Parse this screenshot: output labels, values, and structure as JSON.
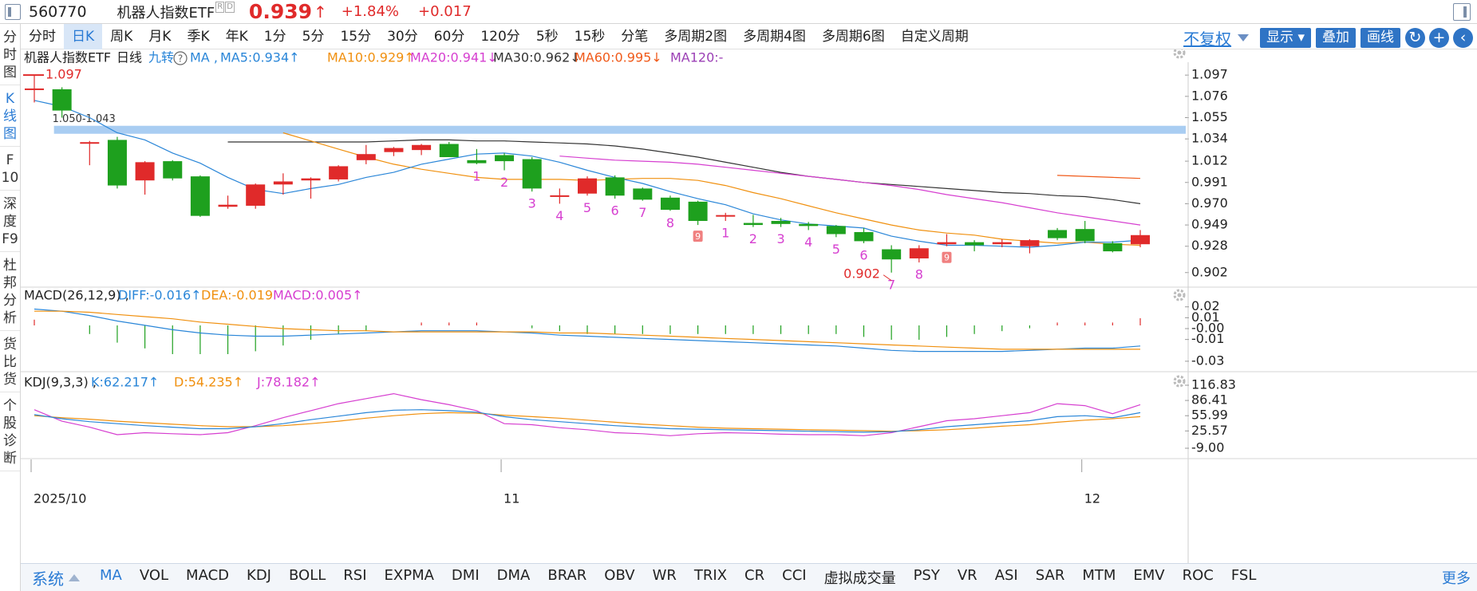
{
  "quote": {
    "code": "560770",
    "name": "机器人指数ETF",
    "badges": [
      "R",
      "D"
    ],
    "price": "0.939",
    "price_arrow": "↑",
    "change_pct": "+1.84%",
    "change_abs": "+0.017"
  },
  "sidebar": {
    "items": [
      {
        "label": "分时图",
        "lines": [
          "分",
          "时",
          "图"
        ],
        "active": false
      },
      {
        "label": "K线图",
        "lines": [
          "K",
          "线",
          "图"
        ],
        "active": true
      },
      {
        "label": "F10",
        "lines": [
          "F",
          "10"
        ],
        "active": false
      },
      {
        "label": "深度F9",
        "lines": [
          "深",
          "度",
          "F9"
        ],
        "active": false
      },
      {
        "label": "杜邦分析",
        "lines": [
          "杜",
          "邦",
          "分",
          "析"
        ],
        "active": false
      },
      {
        "label": "货比货",
        "lines": [
          "货",
          "比",
          "货"
        ],
        "active": false
      },
      {
        "label": "个股诊断",
        "lines": [
          "个",
          "股",
          "诊",
          "断"
        ],
        "active": false
      }
    ]
  },
  "period_tabs": [
    {
      "label": "分时",
      "active": false
    },
    {
      "label": "日K",
      "active": true
    },
    {
      "label": "周K",
      "active": false
    },
    {
      "label": "月K",
      "active": false
    },
    {
      "label": "季K",
      "active": false
    },
    {
      "label": "年K",
      "active": false
    },
    {
      "label": "1分",
      "active": false
    },
    {
      "label": "5分",
      "active": false
    },
    {
      "label": "15分",
      "active": false
    },
    {
      "label": "30分",
      "active": false
    },
    {
      "label": "60分",
      "active": false
    },
    {
      "label": "120分",
      "active": false
    },
    {
      "label": "5秒",
      "active": false
    },
    {
      "label": "15秒",
      "active": false
    },
    {
      "label": "分笔",
      "active": false
    },
    {
      "label": "多周期2图",
      "active": false
    },
    {
      "label": "多周期4图",
      "active": false
    },
    {
      "label": "多周期6图",
      "active": false
    },
    {
      "label": "自定义周期",
      "active": false
    }
  ],
  "toolbar": {
    "fuquan": "不复权",
    "display": "显示",
    "overlay": "叠加",
    "draw": "画线",
    "refresh_icon": "refresh-icon",
    "add_icon": "plus-icon",
    "collapse_icon": "chevron-left-icon"
  },
  "main_header": {
    "name": "机器人指数ETF",
    "period": "日线",
    "jiuzhuan": "九转",
    "ma_label": "MA ,",
    "items": [
      {
        "text": "MA5:0.934↑",
        "color": "#2a86d8"
      },
      {
        "text": "MA10:0.929↑",
        "color": "#f0900f"
      },
      {
        "text": "MA20:0.941↓",
        "color": "#d63fd0"
      },
      {
        "text": "MA30:0.962↓",
        "color": "#333333"
      },
      {
        "text": "MA60:0.995↓",
        "color": "#f05a1a"
      },
      {
        "text": "MA120:-",
        "color": "#9b3fb5"
      }
    ]
  },
  "price_axis": [
    "1.097",
    "1.076",
    "1.055",
    "1.034",
    "1.012",
    "0.991",
    "0.970",
    "0.949",
    "0.928",
    "0.902"
  ],
  "annotations": {
    "high_label": "1.097",
    "low_label": "0.902",
    "band_label": "1.050-1.043"
  },
  "macd_header": {
    "title": "MACD(26,12,9) ,",
    "diff": "DIFF:-0.016↑",
    "dea": "DEA:-0.019",
    "macd": "MACD:0.005↑"
  },
  "macd_axis": [
    "0.02",
    "0.01",
    "-0.00",
    "-0.01",
    "-0.03"
  ],
  "kdj_header": {
    "title": "KDJ(9,3,3) ,",
    "k": "K:62.217↑",
    "d": "D:54.235↑",
    "j": "J:78.182↑"
  },
  "kdj_axis": [
    "116.83",
    "86.41",
    "55.99",
    "25.57",
    "-9.00"
  ],
  "date_axis": [
    "2025/10",
    "11",
    "12"
  ],
  "indicator_bar": {
    "system": "系统",
    "items": [
      "MA",
      "VOL",
      "MACD",
      "KDJ",
      "BOLL",
      "RSI",
      "EXPMA",
      "DMI",
      "DMA",
      "BRAR",
      "OBV",
      "WR",
      "TRIX",
      "CR",
      "CCI",
      "虚拟成交量",
      "PSY",
      "VR",
      "ASI",
      "SAR",
      "MTM",
      "EMV",
      "ROC",
      "FSL"
    ],
    "active": "MA",
    "more": "更多"
  },
  "colors": {
    "up": "#e02a2a",
    "down": "#1ea01e",
    "ma5": "#2a86d8",
    "ma10": "#f0900f",
    "ma20": "#d63fd0",
    "ma30": "#333333",
    "ma60": "#f05a1a",
    "td_seq": "#d63fd0",
    "band": "#a9cdf2"
  },
  "chart_data": {
    "type": "candlestick",
    "ylim": [
      0.89,
      1.105
    ],
    "candles": [
      {
        "o": 1.083,
        "h": 1.097,
        "l": 1.07,
        "c": 1.083,
        "seq": ""
      },
      {
        "o": 1.083,
        "h": 1.085,
        "l": 1.055,
        "c": 1.062,
        "seq": ""
      },
      {
        "o": 1.03,
        "h": 1.032,
        "l": 1.008,
        "c": 1.03,
        "seq": ""
      },
      {
        "o": 1.033,
        "h": 1.036,
        "l": 0.985,
        "c": 0.988,
        "seq": ""
      },
      {
        "o": 0.993,
        "h": 1.012,
        "l": 0.979,
        "c": 1.011,
        "seq": ""
      },
      {
        "o": 1.012,
        "h": 1.013,
        "l": 0.993,
        "c": 0.995,
        "seq": ""
      },
      {
        "o": 0.997,
        "h": 0.998,
        "l": 0.957,
        "c": 0.958,
        "seq": ""
      },
      {
        "o": 0.967,
        "h": 0.978,
        "l": 0.965,
        "c": 0.969,
        "seq": ""
      },
      {
        "o": 0.968,
        "h": 0.99,
        "l": 0.965,
        "c": 0.989,
        "seq": ""
      },
      {
        "o": 0.989,
        "h": 1.0,
        "l": 0.979,
        "c": 0.992,
        "seq": ""
      },
      {
        "o": 0.993,
        "h": 0.996,
        "l": 0.975,
        "c": 0.995,
        "seq": ""
      },
      {
        "o": 0.994,
        "h": 1.008,
        "l": 0.992,
        "c": 1.007,
        "seq": ""
      },
      {
        "o": 1.013,
        "h": 1.028,
        "l": 1.009,
        "c": 1.019,
        "seq": ""
      },
      {
        "o": 1.021,
        "h": 1.026,
        "l": 1.017,
        "c": 1.025,
        "seq": ""
      },
      {
        "o": 1.023,
        "h": 1.029,
        "l": 1.018,
        "c": 1.028,
        "seq": ""
      },
      {
        "o": 1.029,
        "h": 1.031,
        "l": 1.016,
        "c": 1.016,
        "seq": ""
      },
      {
        "o": 1.013,
        "h": 1.024,
        "l": 1.009,
        "c": 1.01,
        "seq": "1"
      },
      {
        "o": 1.018,
        "h": 1.02,
        "l": 1.003,
        "c": 1.012,
        "seq": "2"
      },
      {
        "o": 1.014,
        "h": 1.016,
        "l": 0.982,
        "c": 0.985,
        "seq": "3"
      },
      {
        "o": 0.977,
        "h": 0.985,
        "l": 0.97,
        "c": 0.978,
        "seq": "4"
      },
      {
        "o": 0.98,
        "h": 0.997,
        "l": 0.978,
        "c": 0.995,
        "seq": "5"
      },
      {
        "o": 0.996,
        "h": 0.998,
        "l": 0.975,
        "c": 0.978,
        "seq": "6"
      },
      {
        "o": 0.985,
        "h": 0.986,
        "l": 0.973,
        "c": 0.974,
        "seq": "7"
      },
      {
        "o": 0.976,
        "h": 0.978,
        "l": 0.963,
        "c": 0.964,
        "seq": "8"
      },
      {
        "o": 0.972,
        "h": 0.973,
        "l": 0.949,
        "c": 0.953,
        "seq": "9"
      },
      {
        "o": 0.958,
        "h": 0.961,
        "l": 0.953,
        "c": 0.958,
        "seq": "1"
      },
      {
        "o": 0.951,
        "h": 0.959,
        "l": 0.947,
        "c": 0.949,
        "seq": "2"
      },
      {
        "o": 0.953,
        "h": 0.956,
        "l": 0.947,
        "c": 0.95,
        "seq": "3"
      },
      {
        "o": 0.95,
        "h": 0.952,
        "l": 0.944,
        "c": 0.948,
        "seq": "4"
      },
      {
        "o": 0.948,
        "h": 0.949,
        "l": 0.937,
        "c": 0.94,
        "seq": "5"
      },
      {
        "o": 0.942,
        "h": 0.946,
        "l": 0.931,
        "c": 0.933,
        "seq": "6"
      },
      {
        "o": 0.925,
        "h": 0.929,
        "l": 0.902,
        "c": 0.915,
        "seq": "7"
      },
      {
        "o": 0.916,
        "h": 0.929,
        "l": 0.912,
        "c": 0.926,
        "seq": "8"
      },
      {
        "o": 0.93,
        "h": 0.94,
        "l": 0.928,
        "c": 0.932,
        "seq": "9"
      },
      {
        "o": 0.932,
        "h": 0.934,
        "l": 0.923,
        "c": 0.929,
        "seq": ""
      },
      {
        "o": 0.93,
        "h": 0.935,
        "l": 0.927,
        "c": 0.932,
        "seq": ""
      },
      {
        "o": 0.928,
        "h": 0.935,
        "l": 0.921,
        "c": 0.934,
        "seq": ""
      },
      {
        "o": 0.944,
        "h": 0.946,
        "l": 0.934,
        "c": 0.936,
        "seq": ""
      },
      {
        "o": 0.945,
        "h": 0.953,
        "l": 0.931,
        "c": 0.933,
        "seq": ""
      },
      {
        "o": 0.931,
        "h": 0.933,
        "l": 0.922,
        "c": 0.923,
        "seq": ""
      },
      {
        "o": 0.93,
        "h": 0.944,
        "l": 0.927,
        "c": 0.939,
        "seq": ""
      }
    ],
    "hline": {
      "from": 1.05,
      "to": 1.043
    },
    "ma5": [
      1.072,
      1.066,
      1.055,
      1.04,
      1.033,
      1.02,
      1.01,
      0.996,
      0.984,
      0.98,
      0.985,
      0.989,
      0.996,
      1.001,
      1.009,
      1.014,
      1.019,
      1.02,
      1.017,
      1.011,
      1.003,
      0.996,
      0.99,
      0.982,
      0.975,
      0.969,
      0.96,
      0.954,
      0.95,
      0.948,
      0.946,
      0.938,
      0.933,
      0.929,
      0.929,
      0.928,
      0.927,
      0.929,
      0.932,
      0.932,
      0.934
    ],
    "ma10": [
      null,
      null,
      null,
      null,
      null,
      null,
      null,
      null,
      null,
      1.04,
      1.032,
      1.024,
      1.016,
      1.009,
      1.004,
      1.0,
      0.996,
      0.994,
      0.994,
      0.994,
      0.993,
      0.994,
      0.995,
      0.995,
      0.993,
      0.988,
      0.981,
      0.975,
      0.968,
      0.961,
      0.955,
      0.949,
      0.944,
      0.941,
      0.939,
      0.935,
      0.933,
      0.931,
      0.932,
      0.93,
      0.929
    ],
    "ma20": [
      null,
      null,
      null,
      null,
      null,
      null,
      null,
      null,
      null,
      null,
      null,
      null,
      null,
      null,
      null,
      null,
      null,
      null,
      null,
      1.017,
      1.015,
      1.013,
      1.012,
      1.011,
      1.009,
      1.006,
      1.003,
      1.0,
      0.997,
      0.994,
      0.991,
      0.988,
      0.984,
      0.979,
      0.975,
      0.971,
      0.966,
      0.961,
      0.957,
      0.953,
      0.949
    ],
    "ma30": [
      null,
      null,
      null,
      null,
      null,
      null,
      null,
      1.031,
      1.031,
      1.031,
      1.031,
      1.031,
      1.031,
      1.032,
      1.033,
      1.033,
      1.032,
      1.032,
      1.031,
      1.03,
      1.029,
      1.027,
      1.024,
      1.02,
      1.016,
      1.011,
      1.006,
      1.001,
      0.997,
      0.994,
      0.991,
      0.989,
      0.987,
      0.985,
      0.983,
      0.981,
      0.98,
      0.978,
      0.977,
      0.974,
      0.97
    ],
    "ma60": [
      null,
      null,
      null,
      null,
      null,
      null,
      null,
      null,
      null,
      null,
      null,
      null,
      null,
      null,
      null,
      null,
      null,
      null,
      null,
      null,
      null,
      null,
      null,
      null,
      null,
      null,
      null,
      null,
      null,
      null,
      null,
      null,
      null,
      null,
      null,
      null,
      null,
      0.998,
      0.997,
      0.996,
      0.995
    ],
    "macd_diff": [
      0.018,
      0.016,
      0.012,
      0.007,
      0.003,
      -0.001,
      -0.004,
      -0.006,
      -0.007,
      -0.007,
      -0.006,
      -0.005,
      -0.004,
      -0.003,
      -0.002,
      -0.002,
      -0.002,
      -0.003,
      -0.004,
      -0.006,
      -0.007,
      -0.008,
      -0.009,
      -0.01,
      -0.011,
      -0.012,
      -0.013,
      -0.014,
      -0.015,
      -0.016,
      -0.018,
      -0.02,
      -0.021,
      -0.021,
      -0.021,
      -0.021,
      -0.02,
      -0.019,
      -0.018,
      -0.018,
      -0.016
    ],
    "macd_dea": [
      0.016,
      0.016,
      0.015,
      0.013,
      0.011,
      0.009,
      0.006,
      0.004,
      0.002,
      0.0,
      -0.001,
      -0.002,
      -0.002,
      -0.003,
      -0.003,
      -0.003,
      -0.003,
      -0.003,
      -0.003,
      -0.004,
      -0.004,
      -0.005,
      -0.006,
      -0.007,
      -0.008,
      -0.009,
      -0.01,
      -0.011,
      -0.012,
      -0.013,
      -0.014,
      -0.015,
      -0.016,
      -0.017,
      -0.018,
      -0.019,
      -0.019,
      -0.019,
      -0.019,
      -0.019,
      -0.019
    ],
    "macd_hist": [
      0.004,
      0.0,
      -0.006,
      -0.012,
      -0.016,
      -0.02,
      -0.02,
      -0.02,
      -0.018,
      -0.014,
      -0.01,
      -0.006,
      -0.004,
      0.0,
      0.002,
      0.002,
      0.002,
      0.0,
      -0.002,
      -0.004,
      -0.006,
      -0.006,
      -0.006,
      -0.006,
      -0.006,
      -0.006,
      -0.006,
      -0.006,
      -0.006,
      -0.006,
      -0.008,
      -0.01,
      -0.01,
      -0.008,
      -0.006,
      -0.004,
      -0.002,
      0.002,
      0.002,
      0.002,
      0.005
    ],
    "kdj_k": [
      58,
      50,
      44,
      40,
      36,
      33,
      30,
      30,
      34,
      40,
      48,
      55,
      62,
      67,
      68,
      66,
      63,
      54,
      48,
      44,
      40,
      36,
      33,
      30,
      29,
      28,
      27,
      26,
      25,
      24,
      23,
      24,
      28,
      34,
      38,
      42,
      46,
      54,
      56,
      52,
      62
    ],
    "kdj_d": [
      56,
      52,
      49,
      45,
      42,
      39,
      36,
      34,
      34,
      36,
      40,
      45,
      51,
      56,
      60,
      62,
      61,
      57,
      54,
      51,
      47,
      43,
      39,
      36,
      33,
      31,
      30,
      29,
      28,
      27,
      26,
      25,
      26,
      28,
      31,
      35,
      38,
      43,
      47,
      50,
      54
    ],
    "kdj_j": [
      68,
      45,
      33,
      18,
      22,
      20,
      18,
      22,
      36,
      52,
      66,
      80,
      90,
      100,
      88,
      78,
      66,
      40,
      38,
      32,
      28,
      22,
      20,
      16,
      20,
      22,
      21,
      19,
      18,
      18,
      16,
      22,
      34,
      46,
      50,
      56,
      62,
      80,
      76,
      60,
      78
    ]
  }
}
